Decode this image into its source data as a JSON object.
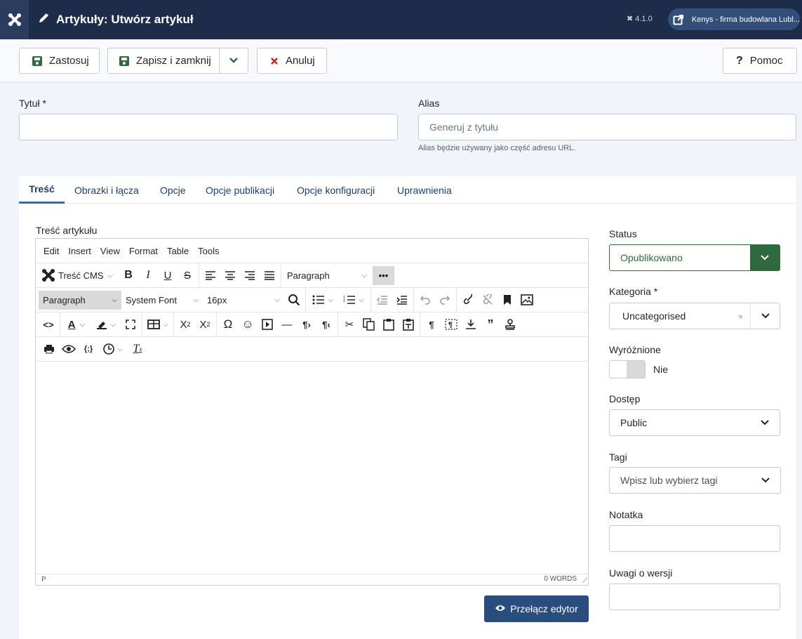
{
  "topbar": {
    "page_title": "Artykuły: Utwórz artykuł",
    "version": "4.1.0",
    "site_name": "Kenys - firma budowlana Lubl..."
  },
  "toolbar": {
    "apply_label": "Zastosuj",
    "save_close_label": "Zapisz i zamknij",
    "cancel_label": "Anuluj",
    "help_label": "Pomoc"
  },
  "form": {
    "title_label": "Tytuł *",
    "title_value": "",
    "alias_label": "Alias",
    "alias_placeholder": "Generuj z tytułu",
    "alias_help": "Alias będzie używany jako część adresu URL."
  },
  "tabs": [
    {
      "label": "Treść",
      "active": true
    },
    {
      "label": "Obrazki i łącza"
    },
    {
      "label": "Opcje"
    },
    {
      "label": "Opcje publikacji"
    },
    {
      "label": "Opcje konfiguracji"
    },
    {
      "label": "Uprawnienia"
    }
  ],
  "editor": {
    "label": "Treść artykułu",
    "menu": [
      "Edit",
      "Insert",
      "View",
      "Format",
      "Table",
      "Tools"
    ],
    "cms_button": "Treść CMS",
    "block_format_1": "Paragraph",
    "block_format_2": "Paragraph",
    "font_family": "System Font",
    "font_size": "16px",
    "status_path": "P",
    "word_count": "0 WORDS",
    "toggle_label": "Przełącz edytor"
  },
  "sidebar": {
    "status_label": "Status",
    "status_value": "Opublikowano",
    "category_label": "Kategoria *",
    "category_value": "Uncategorised",
    "featured_label": "Wyróżnione",
    "featured_value": "Nie",
    "access_label": "Dostęp",
    "access_value": "Public",
    "tags_label": "Tagi",
    "tags_placeholder": "Wpisz lub wybierz tagi",
    "note_label": "Notatka",
    "version_note_label": "Uwagi o wersji"
  },
  "colors": {
    "topbar": "#1c2c49",
    "status_green": "#2f6a3f",
    "primary_button": "#2a4d7e",
    "cancel_red": "#c52827"
  }
}
